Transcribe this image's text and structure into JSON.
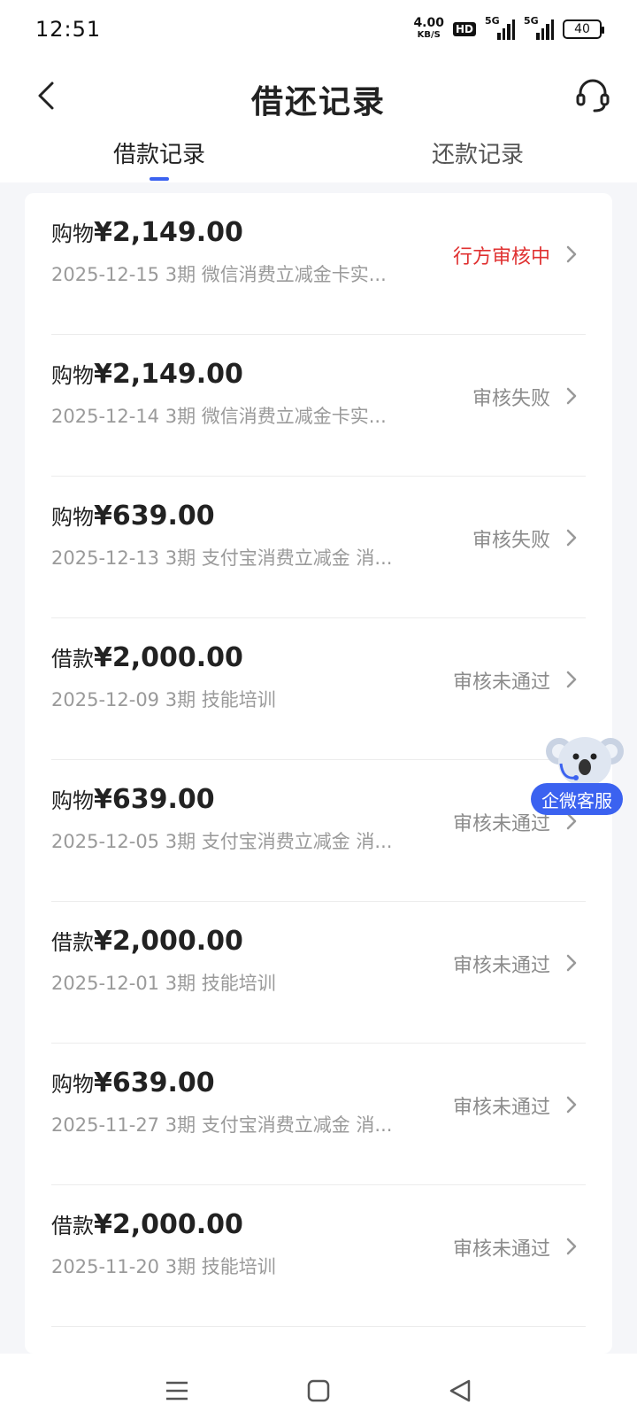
{
  "status_bar": {
    "time": "12:51",
    "net_speed": "4.00",
    "net_unit": "KB/S",
    "hd": "HD",
    "sim1": "5G",
    "sim2": "5G",
    "battery": "40"
  },
  "header": {
    "title": "借还记录",
    "back_icon": "chevron-left-icon",
    "support_icon": "headset-icon"
  },
  "tabs": [
    {
      "label": "借款记录",
      "active": true
    },
    {
      "label": "还款记录",
      "active": false
    }
  ],
  "colors": {
    "accent": "#3b62f0",
    "pending": "#e03131",
    "muted": "#8c8c8c"
  },
  "records": [
    {
      "kind": "购物",
      "amount": "¥2,149.00",
      "sub": "2025-12-15 3期  微信消费立减金卡实...",
      "status": "行方审核中",
      "state": "pending"
    },
    {
      "kind": "购物",
      "amount": "¥2,149.00",
      "sub": "2025-12-14 3期  微信消费立减金卡实...",
      "status": "审核失败",
      "state": "failed"
    },
    {
      "kind": "购物",
      "amount": "¥639.00",
      "sub": "2025-12-13 3期  支付宝消费立减金 消...",
      "status": "审核失败",
      "state": "failed"
    },
    {
      "kind": "借款",
      "amount": "¥2,000.00",
      "sub": "2025-12-09 3期  技能培训",
      "status": "审核未通过",
      "state": "rejected"
    },
    {
      "kind": "购物",
      "amount": "¥639.00",
      "sub": "2025-12-05 3期  支付宝消费立减金 消...",
      "status": "审核未通过",
      "state": "rejected"
    },
    {
      "kind": "借款",
      "amount": "¥2,000.00",
      "sub": "2025-12-01 3期  技能培训",
      "status": "审核未通过",
      "state": "rejected"
    },
    {
      "kind": "购物",
      "amount": "¥639.00",
      "sub": "2025-11-27 3期  支付宝消费立减金 消...",
      "status": "审核未通过",
      "state": "rejected"
    },
    {
      "kind": "借款",
      "amount": "¥2,000.00",
      "sub": "2025-11-20 3期  技能培训",
      "status": "审核未通过",
      "state": "rejected"
    }
  ],
  "floating_service": {
    "label": "企微客服",
    "icon": "koala-mascot-icon"
  },
  "nav_bar": {
    "menu_icon": "menu-icon",
    "home_icon": "home-square-icon",
    "back_icon": "back-triangle-icon"
  }
}
